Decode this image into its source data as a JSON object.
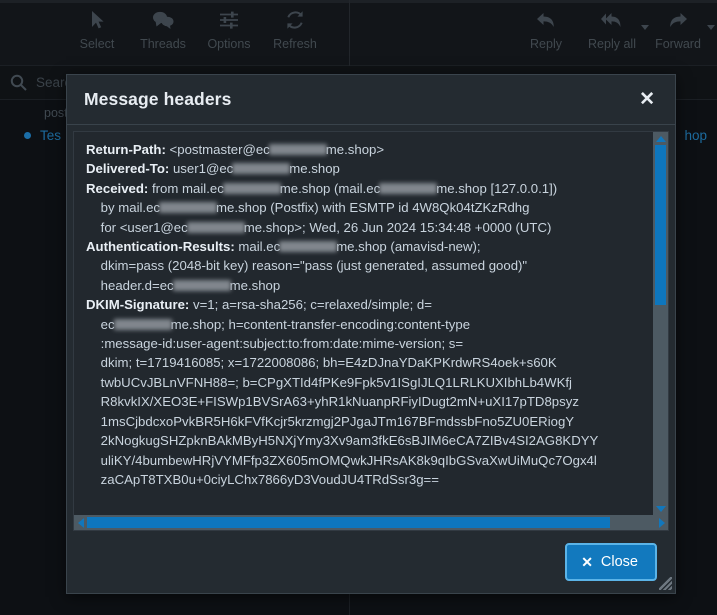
{
  "window": {
    "background_color": "#0d1014",
    "accent_color": "#1279be"
  },
  "toolbar": {
    "left_buttons": [
      {
        "label": "Select",
        "icon": "cursor-arrow-icon",
        "caret": false
      },
      {
        "label": "Threads",
        "icon": "speech-bubbles-icon",
        "caret": false
      },
      {
        "label": "Options",
        "icon": "sliders-icon",
        "caret": false
      },
      {
        "label": "Refresh",
        "icon": "refresh-icon",
        "caret": false
      }
    ],
    "right_buttons": [
      {
        "label": "Reply",
        "icon": "reply-arrow-icon",
        "caret": false
      },
      {
        "label": "Reply all",
        "icon": "reply-all-arrow-icon",
        "caret": true
      },
      {
        "label": "Forward",
        "icon": "forward-arrow-icon",
        "caret": true
      }
    ]
  },
  "search": {
    "placeholder": "Search…",
    "icon": "search-icon"
  },
  "message_list": {
    "from_preview": "post",
    "subject_preview": "Tes",
    "right_preview": "hop"
  },
  "dialog": {
    "title": "Message headers",
    "close_icon": "close-icon",
    "close_button": {
      "label": "Close",
      "icon": "close-x-icon"
    },
    "resize_handle": "resize-grip",
    "scrollbars": {
      "vertical": {
        "up_icon": "caret-up-icon",
        "down_icon": "caret-down-icon"
      },
      "horizontal": {
        "left_icon": "caret-left-icon",
        "right_icon": "caret-right-icon"
      }
    },
    "headers_lines": [
      {
        "name": "Return-Path:",
        "parts": [
          "<postmaster@ec",
          "REDACT",
          "me.shop>"
        ]
      },
      {
        "name": "Delivered-To:",
        "parts": [
          "user1@ec",
          "REDACT",
          "me.shop"
        ]
      },
      {
        "name": "Received:",
        "parts": [
          "from mail.ec",
          "REDACT",
          "me.shop (mail.ec",
          "REDACT",
          "me.shop [127.0.0.1])"
        ]
      },
      {
        "name": "",
        "indent": true,
        "parts": [
          "by mail.ec",
          "REDACT",
          "me.shop (Postfix) with ESMTP id 4W8Qk04tZKzRdhg"
        ]
      },
      {
        "name": "",
        "indent": true,
        "parts": [
          "for <user1@ec",
          "REDACT",
          "me.shop>; Wed, 26 Jun 2024 15:34:48 +0000 (UTC)"
        ]
      },
      {
        "name": "Authentication-Results:",
        "parts": [
          "mail.ec",
          "REDACT",
          "me.shop (amavisd-new);"
        ]
      },
      {
        "name": "",
        "indent": true,
        "parts": [
          "dkim=pass (2048-bit key) reason=\"pass (just generated, assumed good)\""
        ]
      },
      {
        "name": "",
        "indent": true,
        "parts": [
          "header.d=ec",
          "REDACT",
          "me.shop"
        ]
      },
      {
        "name": "DKIM-Signature:",
        "parts": [
          "v=1; a=rsa-sha256; c=relaxed/simple; d="
        ]
      },
      {
        "name": "",
        "indent": true,
        "parts": [
          "ec",
          "REDACT",
          "me.shop; h=content-transfer-encoding:content-type"
        ]
      },
      {
        "name": "",
        "indent": true,
        "parts": [
          ":message-id:user-agent:subject:to:from:date:mime-version; s="
        ]
      },
      {
        "name": "",
        "indent": true,
        "parts": [
          "dkim; t=1719416085; x=1722008086; bh=E4zDJnaYDaKPKrdwRS4oek+s60K"
        ]
      },
      {
        "name": "",
        "indent": true,
        "parts": [
          "twbUCvJBLnVFNH88=; b=CPgXTId4fPKe9Fpk5v1ISgIJLQ1LRLKUXIbhLb4WKfj"
        ]
      },
      {
        "name": "",
        "indent": true,
        "parts": [
          "R8kvkIX/XEO3E+FISWp1BVSrA63+yhR1kNuanpRFiyIDugt2mN+uXI17pTD8psyz"
        ]
      },
      {
        "name": "",
        "indent": true,
        "parts": [
          "1msCjbdcxoPvkBR5H6kFVfKcjr5krzmgj2PJgaJTm167BFmdssbFno5ZU0ERiogY"
        ]
      },
      {
        "name": "",
        "indent": true,
        "parts": [
          "2kNogkugSHZpknBAkMByH5NXjYmy3Xv9am3fkE6sBJIM6eCA7ZIBv4SI2AG8KDYY"
        ]
      },
      {
        "name": "",
        "indent": true,
        "parts": [
          "uliKY/4bumbewHRjVYMFfp3ZX605mOMQwkJHRsAK8k9qIbGSvaXwUiMuQc7Ogx4l"
        ]
      },
      {
        "name": "",
        "indent": true,
        "parts": [
          "zaCApT8TXB0u+0ciyLChx7866yD3VoudJU4TRdSsr3g=="
        ]
      }
    ]
  }
}
